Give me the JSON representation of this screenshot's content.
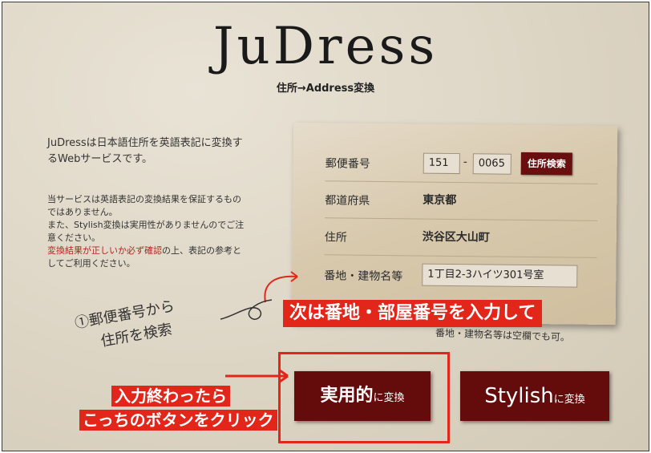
{
  "header": {
    "logo": "JuDress",
    "subtitle": "住所→Address変換"
  },
  "intro": {
    "text": "JuDressは日本語住所を英語表記に変換するWebサービスです。"
  },
  "disclaimer": {
    "line1": "当サービスは英語表記の変換結果を保証するものではありません。",
    "line2": "また、Stylish変換は実用性がありませんのでご注意ください。",
    "line3_red": "変換結果が正しいか必ず確認",
    "line3_rest": "の上、表記の参考としてご利用ください。"
  },
  "form": {
    "postal_label": "郵便番号",
    "postal_part1": "151",
    "postal_separator": "-",
    "postal_part2": "0065",
    "postal_search_button": "住所検索",
    "prefecture_label": "都道府県",
    "prefecture_value": "東京都",
    "address_label": "住所",
    "address_value": "渋谷区大山町",
    "building_label": "番地・建物名等",
    "building_value": "1丁目2-3ハイツ301号室"
  },
  "annotations": {
    "step1_line1": "①郵便番号から",
    "step1_line2": "住所を検索",
    "next_step": "次は番地・部屋番号を入力して",
    "optional_note": "番地・建物名等は空欄でも可。",
    "click_line1": "入力終わったら",
    "click_line2": "こっちのボタンをクリック"
  },
  "buttons": {
    "practical_main": "実用的",
    "practical_suffix": "に変換",
    "stylish_main": "Stylish",
    "stylish_suffix": "に変換"
  },
  "colors": {
    "button_bg": "#640b0b",
    "annotation_red": "#e3261a",
    "background": "#ddd5c4"
  }
}
